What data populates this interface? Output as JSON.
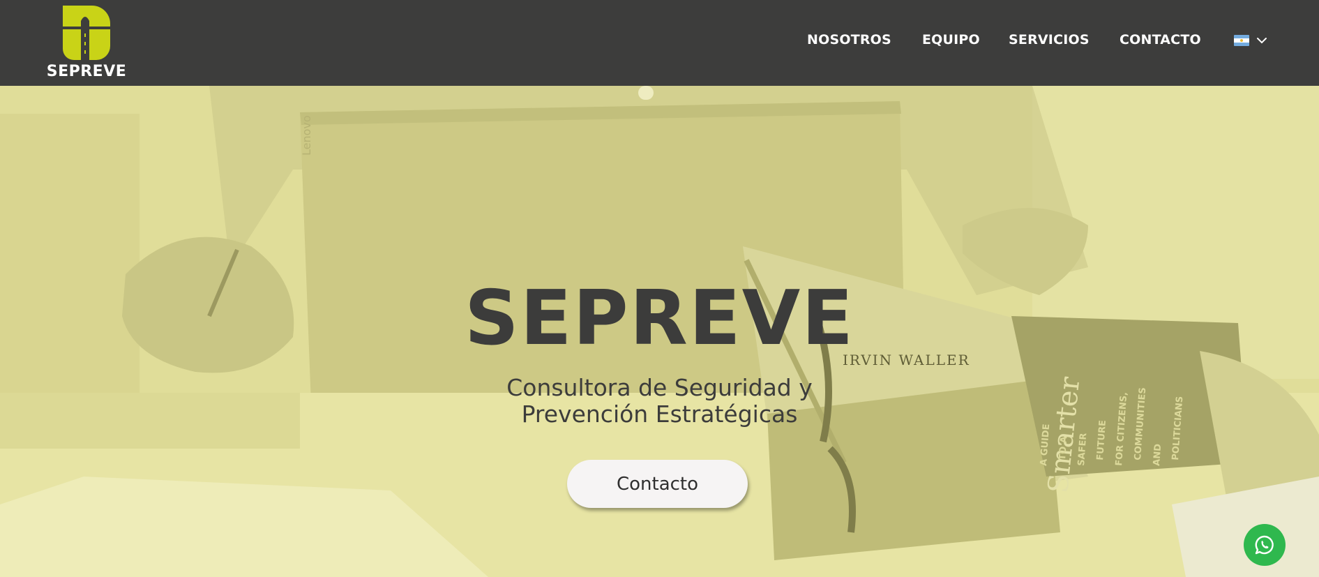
{
  "colors": {
    "header_bg": "#3d3d3c",
    "brand_accent": "#c9d317",
    "hero_tint": "#e3e09c",
    "text_dark": "#3c3c3b",
    "whatsapp": "#2fb84e"
  },
  "header": {
    "logo_icon": "sepreve-logo-icon",
    "logo_text": "SEPREVE",
    "nav": [
      {
        "label": "NOSOTROS"
      },
      {
        "label": "EQUIPO"
      },
      {
        "label": "SERVICIOS"
      },
      {
        "label": "CONTACTO"
      }
    ],
    "language": {
      "flag_icon": "argentina-flag-icon",
      "chevron_icon": "chevron-down-icon"
    }
  },
  "hero": {
    "title": "SEPREVE",
    "subtitle_line1": "Consultora de Seguridad y",
    "subtitle_line2": "Prevención Estratégicas",
    "cta_label": "Contacto",
    "photo_text": {
      "laptop_brand": "Lenovo",
      "book_author": "IRVIN WALLER",
      "book_title": "Smarter",
      "book_subtitle": [
        "A GUIDE",
        "TO A",
        "SAFER",
        "FUTURE",
        "FOR CITIZENS,",
        "COMMUNITIES",
        "AND",
        "POLITICIANS"
      ]
    }
  },
  "whatsapp": {
    "icon": "whatsapp-icon"
  }
}
